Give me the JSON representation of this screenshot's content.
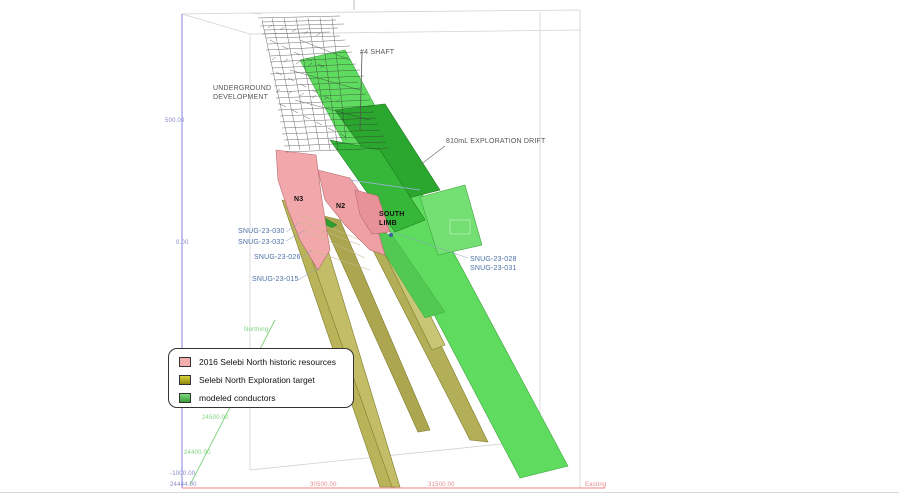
{
  "labels": {
    "shaft": "#4 SHAFT",
    "underground_1": "UNDERGROUND",
    "underground_2": "DEVELOPMENT",
    "drift": "810mL EXPLORATION DRIFT",
    "n3": "N3",
    "n2": "N2",
    "south_limb_1": "SOUTH",
    "south_limb_2": "LIMB"
  },
  "drillholes": {
    "left": [
      "SNUG-23-030",
      "SNUG-23-032",
      "SNUG-23-026",
      "SNUG-23-015"
    ],
    "right": [
      "SNUG-23-028",
      "SNUG-23-031"
    ]
  },
  "axes": {
    "z_500": "500.00",
    "z_0": "0.00",
    "z_neg1000": "-1000.00",
    "north_1": "Northing",
    "north_2": "24500.00",
    "north_3": "24400.00",
    "north_4": "24444.00",
    "east_1": "30500.00",
    "east_2": "31500.00",
    "east_3": "Easting"
  },
  "legend": {
    "items": [
      {
        "label": "2016 Selebi North historic resources",
        "color": "#f4aeb0"
      },
      {
        "label": "Selebi North Exploration target",
        "color": "#b8b81e"
      },
      {
        "label": "modeled conductors",
        "color": "#4cb84c"
      }
    ]
  },
  "colors": {
    "resource": "#f2a7aa",
    "target": "#b6b25a",
    "conductor_light": "#5fdc5f",
    "conductor_dark": "#27a52a",
    "box": "#d0d0d0"
  }
}
